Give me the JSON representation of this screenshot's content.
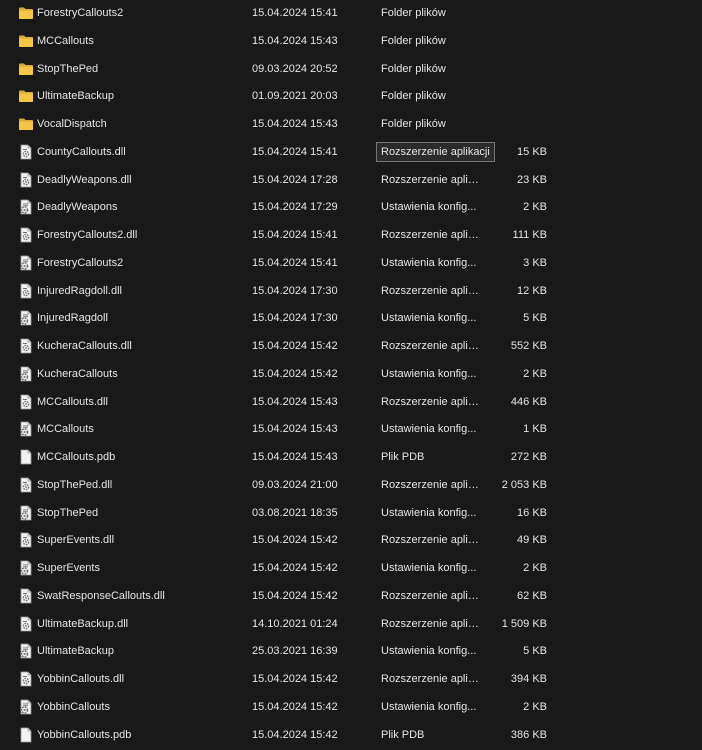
{
  "files": [
    {
      "name": "ForestryCallouts2",
      "date": "15.04.2024 15:41",
      "type": "Folder plików",
      "size": "",
      "icon": "folder-icon"
    },
    {
      "name": "MCCallouts",
      "date": "15.04.2024 15:43",
      "type": "Folder plików",
      "size": "",
      "icon": "folder-icon"
    },
    {
      "name": "StopThePed",
      "date": "09.03.2024 20:52",
      "type": "Folder plików",
      "size": "",
      "icon": "folder-icon"
    },
    {
      "name": "UltimateBackup",
      "date": "01.09.2021 20:03",
      "type": "Folder plików",
      "size": "",
      "icon": "folder-icon"
    },
    {
      "name": "VocalDispatch",
      "date": "15.04.2024 15:43",
      "type": "Folder plików",
      "size": "",
      "icon": "folder-icon"
    },
    {
      "name": "CountyCallouts.dll",
      "date": "15.04.2024 15:41",
      "type": "Rozszerzenie aplikacji",
      "size": "15 KB",
      "icon": "dll-icon",
      "tooltip": true
    },
    {
      "name": "DeadlyWeapons.dll",
      "date": "15.04.2024 17:28",
      "type": "Rozszerzenie aplik...",
      "size": "23 KB",
      "icon": "dll-icon"
    },
    {
      "name": "DeadlyWeapons",
      "date": "15.04.2024 17:29",
      "type": "Ustawienia konfig...",
      "size": "2 KB",
      "icon": "config-icon"
    },
    {
      "name": "ForestryCallouts2.dll",
      "date": "15.04.2024 15:41",
      "type": "Rozszerzenie aplik...",
      "size": "111 KB",
      "icon": "dll-icon"
    },
    {
      "name": "ForestryCallouts2",
      "date": "15.04.2024 15:41",
      "type": "Ustawienia konfig...",
      "size": "3 KB",
      "icon": "config-icon"
    },
    {
      "name": "InjuredRagdoll.dll",
      "date": "15.04.2024 17:30",
      "type": "Rozszerzenie aplik...",
      "size": "12 KB",
      "icon": "dll-icon"
    },
    {
      "name": "InjuredRagdoll",
      "date": "15.04.2024 17:30",
      "type": "Ustawienia konfig...",
      "size": "5 KB",
      "icon": "config-icon"
    },
    {
      "name": "KucheraCallouts.dll",
      "date": "15.04.2024 15:42",
      "type": "Rozszerzenie aplik...",
      "size": "552 KB",
      "icon": "dll-icon"
    },
    {
      "name": "KucheraCallouts",
      "date": "15.04.2024 15:42",
      "type": "Ustawienia konfig...",
      "size": "2 KB",
      "icon": "config-icon"
    },
    {
      "name": "MCCallouts.dll",
      "date": "15.04.2024 15:43",
      "type": "Rozszerzenie aplik...",
      "size": "446 KB",
      "icon": "dll-icon"
    },
    {
      "name": "MCCallouts",
      "date": "15.04.2024 15:43",
      "type": "Ustawienia konfig...",
      "size": "1 KB",
      "icon": "config-icon"
    },
    {
      "name": "MCCallouts.pdb",
      "date": "15.04.2024 15:43",
      "type": "Plik PDB",
      "size": "272 KB",
      "icon": "blank-file-icon"
    },
    {
      "name": "StopThePed.dll",
      "date": "09.03.2024 21:00",
      "type": "Rozszerzenie aplik...",
      "size": "2 053 KB",
      "icon": "dll-icon"
    },
    {
      "name": "StopThePed",
      "date": "03.08.2021 18:35",
      "type": "Ustawienia konfig...",
      "size": "16 KB",
      "icon": "config-icon"
    },
    {
      "name": "SuperEvents.dll",
      "date": "15.04.2024 15:42",
      "type": "Rozszerzenie aplik...",
      "size": "49 KB",
      "icon": "dll-icon"
    },
    {
      "name": "SuperEvents",
      "date": "15.04.2024 15:42",
      "type": "Ustawienia konfig...",
      "size": "2 KB",
      "icon": "config-icon"
    },
    {
      "name": "SwatResponseCallouts.dll",
      "date": "15.04.2024 15:42",
      "type": "Rozszerzenie aplik...",
      "size": "62 KB",
      "icon": "dll-icon"
    },
    {
      "name": "UltimateBackup.dll",
      "date": "14.10.2021 01:24",
      "type": "Rozszerzenie aplik...",
      "size": "1 509 KB",
      "icon": "dll-icon"
    },
    {
      "name": "UltimateBackup",
      "date": "25.03.2021 16:39",
      "type": "Ustawienia konfig...",
      "size": "5 KB",
      "icon": "config-icon"
    },
    {
      "name": "YobbinCallouts.dll",
      "date": "15.04.2024 15:42",
      "type": "Rozszerzenie aplik...",
      "size": "394 KB",
      "icon": "dll-icon"
    },
    {
      "name": "YobbinCallouts",
      "date": "15.04.2024 15:42",
      "type": "Ustawienia konfig...",
      "size": "2 KB",
      "icon": "config-icon"
    },
    {
      "name": "YobbinCallouts.pdb",
      "date": "15.04.2024 15:42",
      "type": "Plik PDB",
      "size": "386 KB",
      "icon": "blank-file-icon"
    }
  ],
  "colors": {
    "background": "#191919",
    "text": "#e6e6e6",
    "folder": "#f4c646",
    "folder_dark": "#dba935",
    "file": "#f2f2f2",
    "file_outline": "#9a9a9a",
    "gear": "#6f6f6f",
    "tooltip_border": "#767676"
  }
}
